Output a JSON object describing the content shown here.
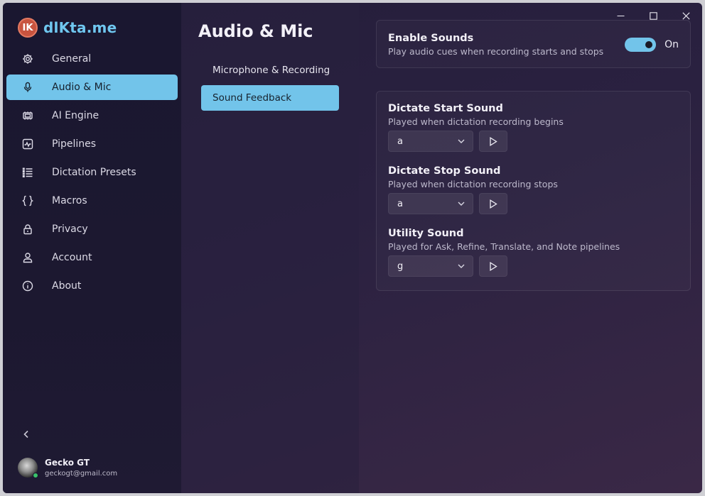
{
  "brand": {
    "logo_text": "IK",
    "name": "dlKta.me"
  },
  "sidebar": {
    "items": [
      {
        "label": "General",
        "icon": "gear-icon",
        "active": false
      },
      {
        "label": "Audio & Mic",
        "icon": "microphone-icon",
        "active": true
      },
      {
        "label": "AI Engine",
        "icon": "chip-icon",
        "active": false
      },
      {
        "label": "Pipelines",
        "icon": "pulse-icon",
        "active": false
      },
      {
        "label": "Dictation Presets",
        "icon": "list-icon",
        "active": false
      },
      {
        "label": "Macros",
        "icon": "braces-icon",
        "active": false
      },
      {
        "label": "Privacy",
        "icon": "lock-icon",
        "active": false
      },
      {
        "label": "Account",
        "icon": "user-icon",
        "active": false
      },
      {
        "label": "About",
        "icon": "info-icon",
        "active": false
      }
    ]
  },
  "user": {
    "name": "Gecko GT",
    "email": "geckogt@gmail.com"
  },
  "page": {
    "title": "Audio & Mic"
  },
  "subnav": {
    "items": [
      {
        "label": "Microphone & Recording",
        "active": false
      },
      {
        "label": "Sound Feedback",
        "active": true
      }
    ]
  },
  "enable_sounds": {
    "title": "Enable Sounds",
    "description": "Play audio cues when recording starts and stops",
    "state_label": "On",
    "enabled": true
  },
  "sounds": [
    {
      "title": "Dictate Start Sound",
      "description": "Played when dictation recording begins",
      "value": "a"
    },
    {
      "title": "Dictate Stop Sound",
      "description": "Played when dictation recording stops",
      "value": "a"
    },
    {
      "title": "Utility Sound",
      "description": "Played for Ask, Refine, Translate, and Note pipelines",
      "value": "g"
    }
  ],
  "colors": {
    "accent": "#72c4ea",
    "brand_name": "#6fc7ef",
    "logo": "#c8543f",
    "online": "#39c36a"
  }
}
